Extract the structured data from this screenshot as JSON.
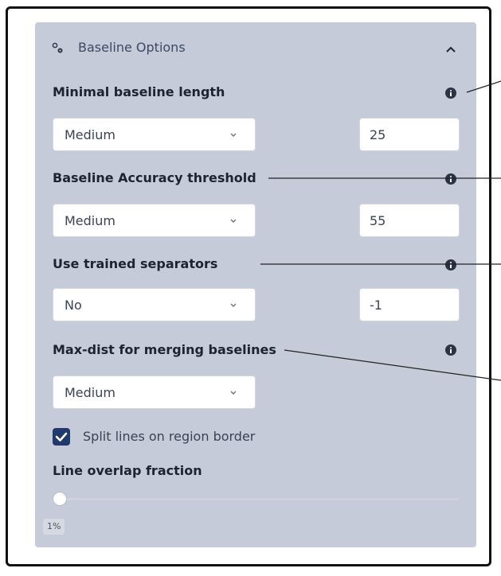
{
  "panel": {
    "title": "Baseline Options",
    "icons": {
      "header": "gears-icon",
      "collapse": "chevron-up-icon",
      "info": "info-icon",
      "dropdown": "chevron-down-icon",
      "check": "checkmark-icon"
    },
    "colors": {
      "panel_bg": "#c5cbd8",
      "accent": "#1f3a6b",
      "label": "#1e2330"
    }
  },
  "options": [
    {
      "label": "Minimal baseline length",
      "select_value": "Medium",
      "number_value": "25"
    },
    {
      "label": "Baseline Accuracy threshold",
      "select_value": "Medium",
      "number_value": "55"
    },
    {
      "label": "Use trained separators",
      "select_value": "No",
      "number_value": "-1"
    },
    {
      "label": "Max-dist for merging baselines",
      "select_value": "Medium"
    }
  ],
  "split_lines": {
    "label": "Split lines on region border",
    "checked": true
  },
  "overlap": {
    "label": "Line overlap fraction",
    "value_label": "1%",
    "fraction": 0.01
  }
}
